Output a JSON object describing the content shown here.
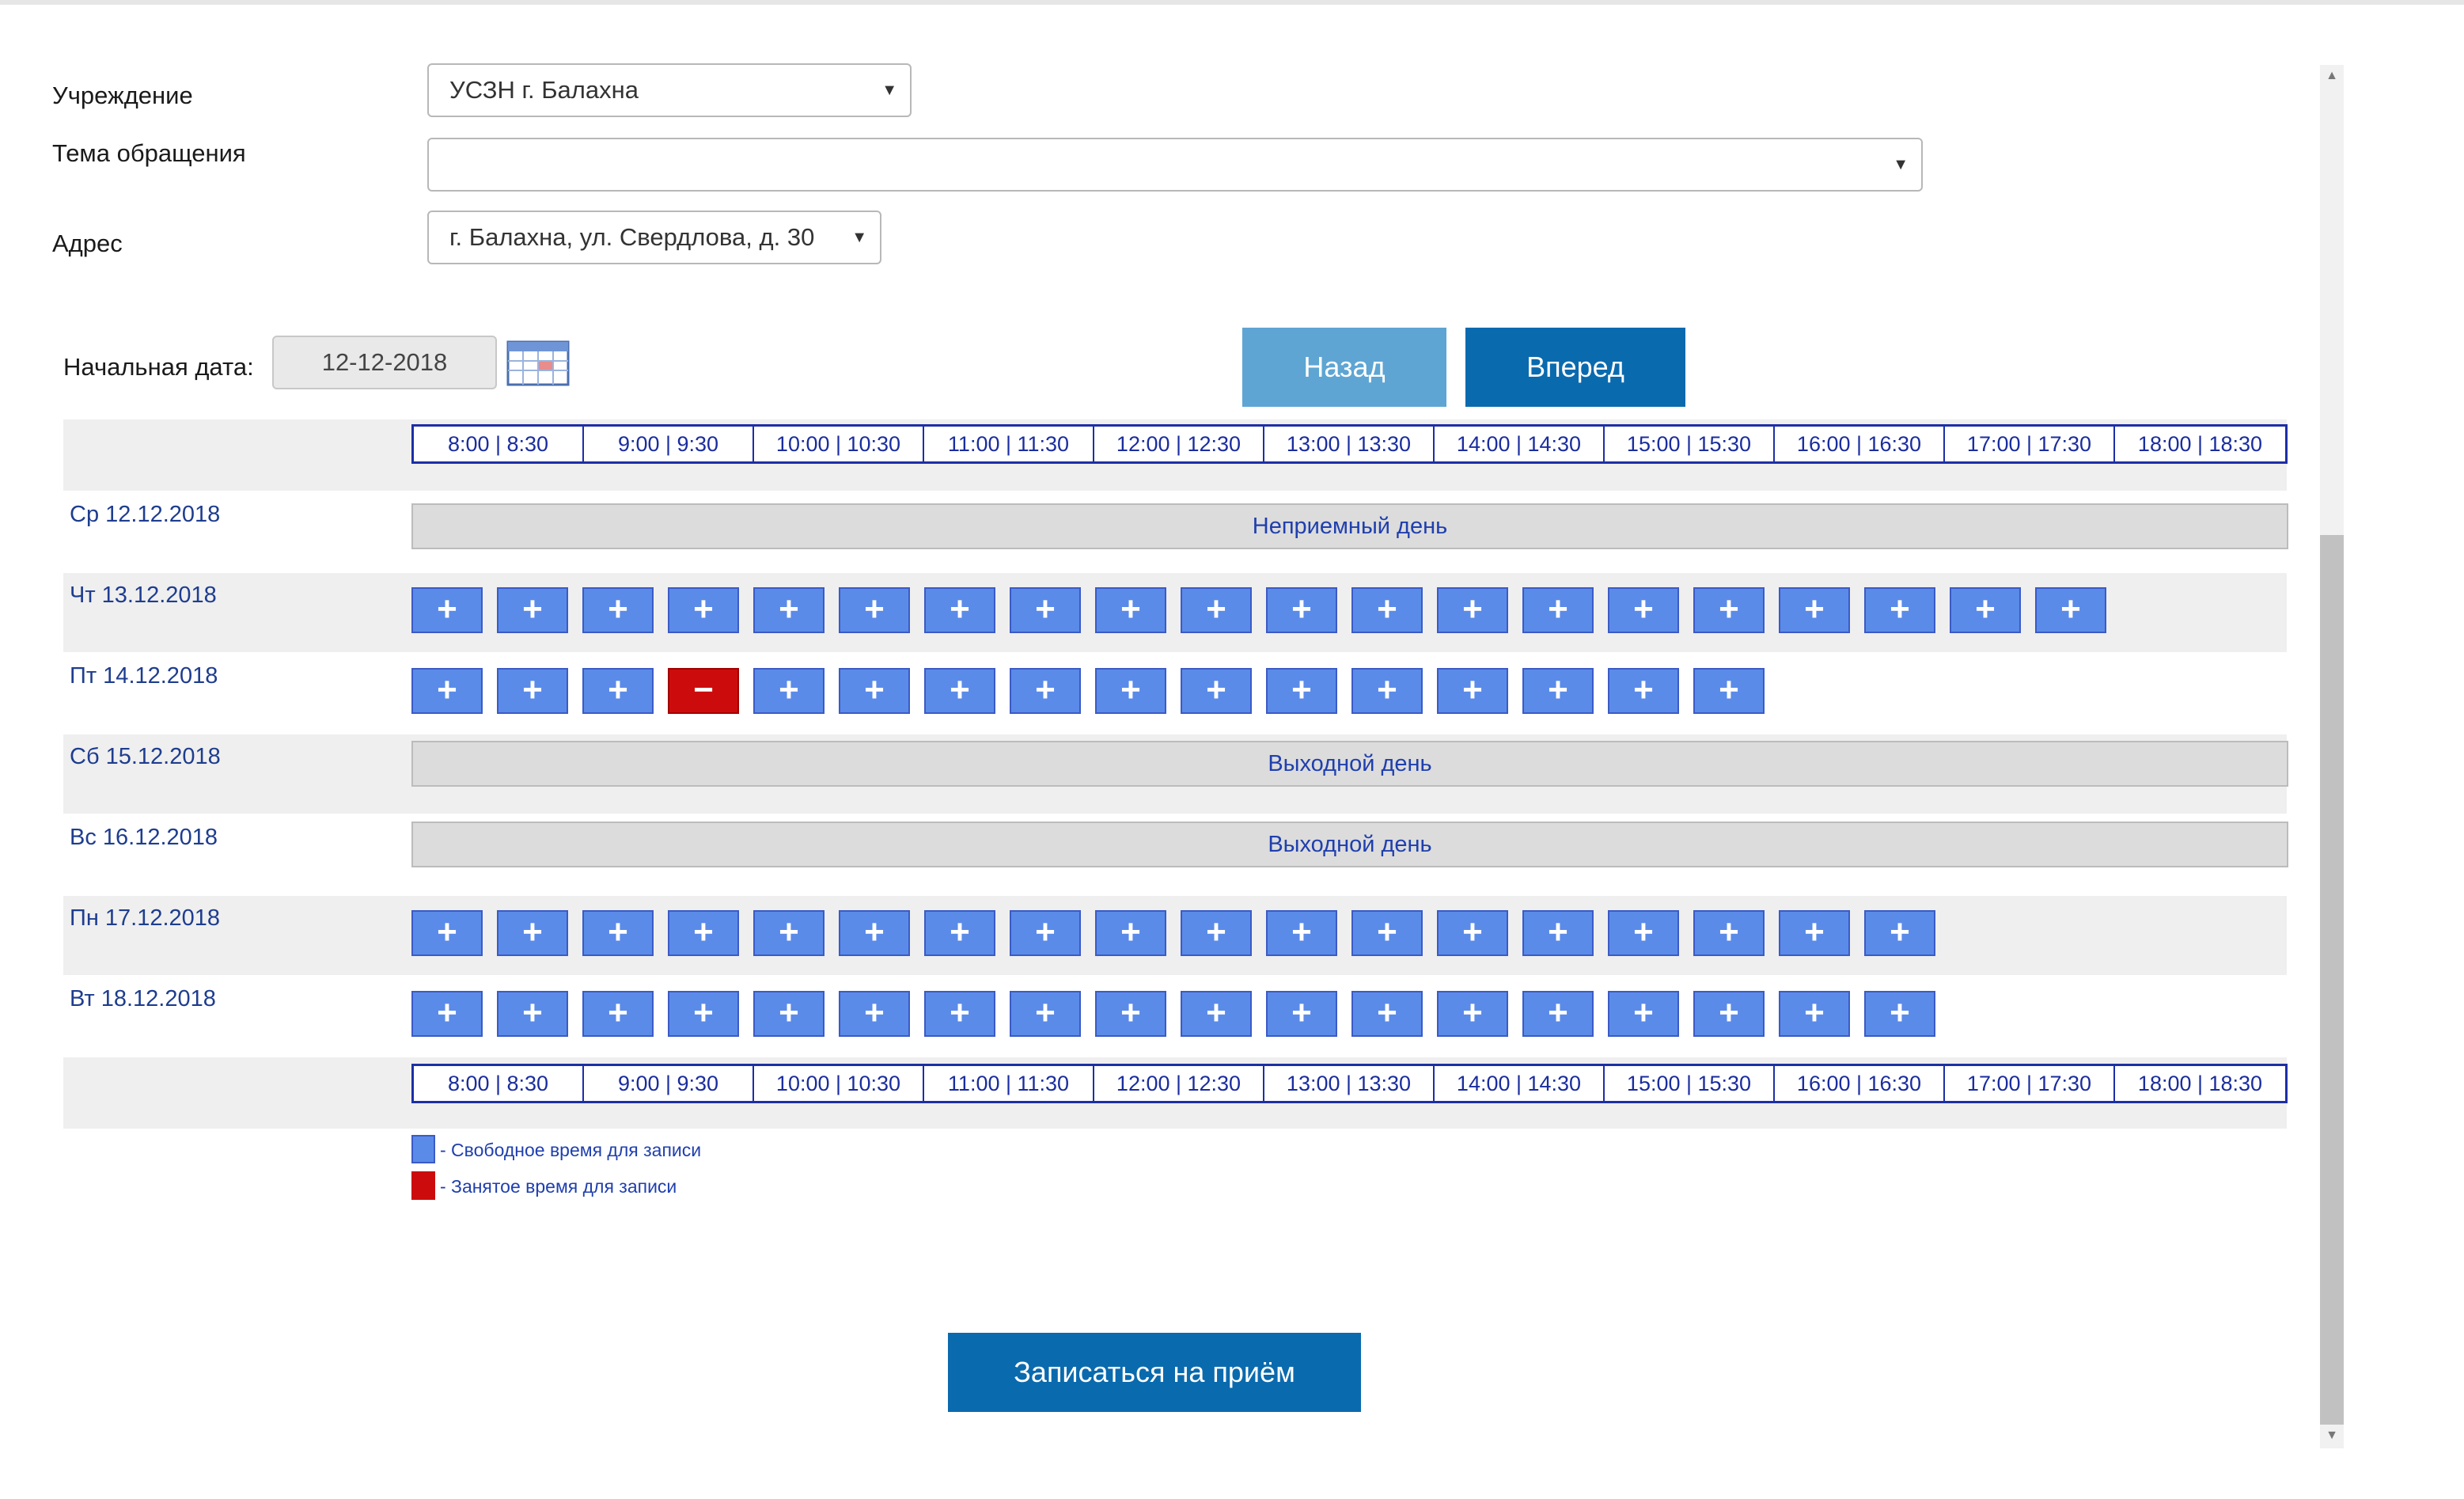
{
  "form": {
    "institution_label": "Учреждение",
    "institution_value": "УСЗН г. Балахна",
    "topic_label": "Тема обращения",
    "topic_value": "",
    "address_label": "Адрес",
    "address_value": "г. Балахна, ул. Свердлова, д. 30",
    "start_date_label": "Начальная дата:",
    "start_date_value": "12-12-2018"
  },
  "nav": {
    "back_label": "Назад",
    "forward_label": "Вперед"
  },
  "time_header": [
    "8:00 | 8:30",
    "9:00 | 9:30",
    "10:00 | 10:30",
    "11:00 | 11:30",
    "12:00 | 12:30",
    "13:00 | 13:30",
    "14:00 | 14:30",
    "15:00 | 15:30",
    "16:00 | 16:30",
    "17:00 | 17:30",
    "18:00 | 18:30"
  ],
  "days": [
    {
      "label": "Ср 12.12.2018",
      "closed": "Неприемный день"
    },
    {
      "label": "Чт 13.12.2018",
      "slots": [
        "+",
        "+",
        "+",
        "+",
        "+",
        "+",
        "+",
        "+",
        "+",
        "+",
        "+",
        "+",
        "+",
        "+",
        "+",
        "+",
        "+",
        "+",
        "+",
        "+"
      ]
    },
    {
      "label": "Пт 14.12.2018",
      "slots": [
        "+",
        "+",
        "+",
        "−",
        "+",
        "+",
        "+",
        "+",
        "+",
        "+",
        "+",
        "+",
        "+",
        "+",
        "+",
        "+"
      ],
      "busy_index": 3
    },
    {
      "label": "Сб 15.12.2018",
      "closed": "Выходной день"
    },
    {
      "label": "Вс 16.12.2018",
      "closed": "Выходной день"
    },
    {
      "label": "Пн 17.12.2018",
      "slots": [
        "+",
        "+",
        "+",
        "+",
        "+",
        "+",
        "+",
        "+",
        "+",
        "+",
        "+",
        "+",
        "+",
        "+",
        "+",
        "+",
        "+",
        "+"
      ]
    },
    {
      "label": "Вт 18.12.2018",
      "slots": [
        "+",
        "+",
        "+",
        "+",
        "+",
        "+",
        "+",
        "+",
        "+",
        "+",
        "+",
        "+",
        "+",
        "+",
        "+",
        "+",
        "+",
        "+"
      ]
    }
  ],
  "legend": {
    "free_text": "- Свободное время для записи",
    "busy_text": "- Занятое время для записи",
    "free_color": "#5b8be8",
    "busy_color": "#cc0c0c"
  },
  "submit_label": "Записаться на приём",
  "colors": {
    "primary": "#0a6aae",
    "back_button": "#5ea5d3",
    "header_border": "#1c2fa6"
  }
}
